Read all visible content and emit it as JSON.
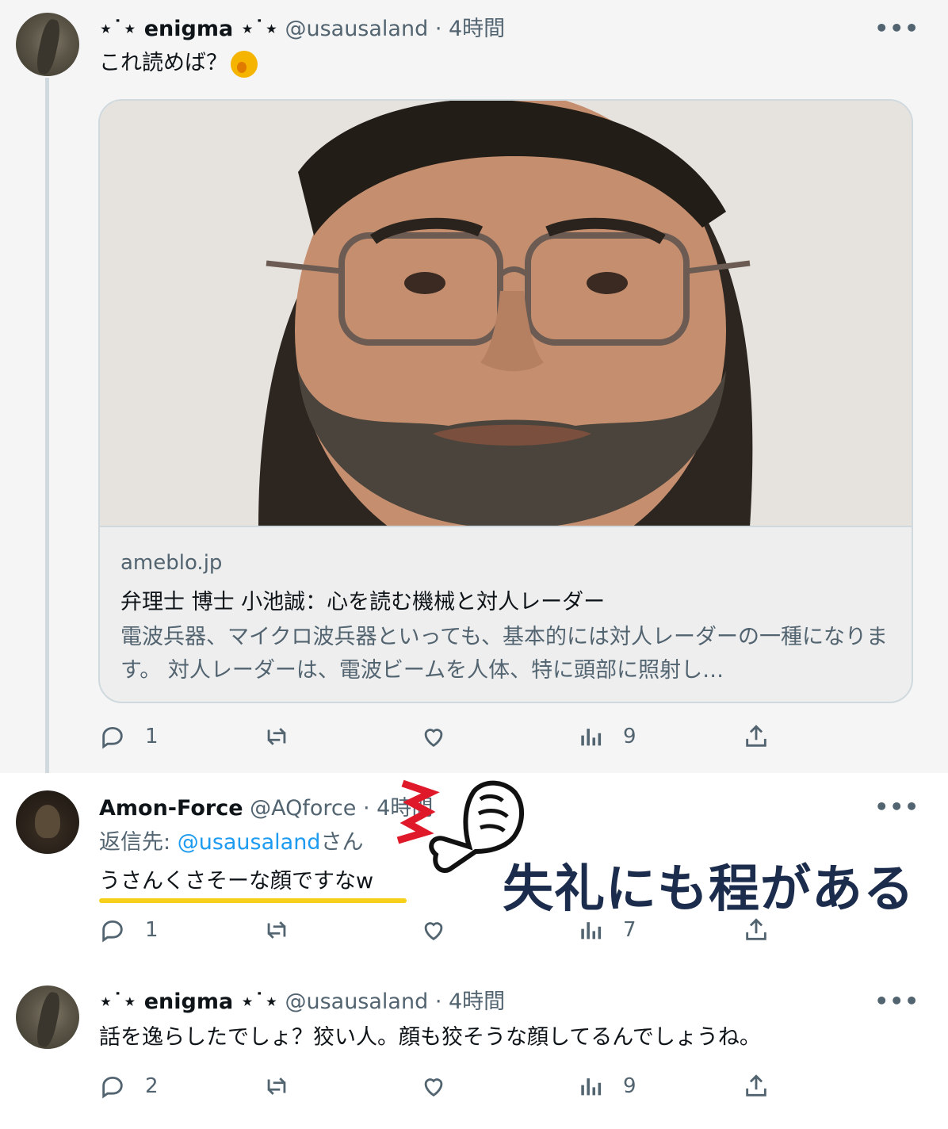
{
  "thread": [
    {
      "name": "⋆˙⋆ enigma ⋆˙⋆",
      "handle": "@usausaland",
      "separator": "·",
      "time": "4時間",
      "text": "これ読めば？",
      "emoji_icon": "yawning-face-emoji",
      "card": {
        "domain": "ameblo.jp",
        "title": "弁理士 博士 小池誠：心を読む機械と対人レーダー",
        "description": "電波兵器、マイクロ波兵器といっても、基本的には対人レーダーの一種になります。 対人レーダーは、電波ビームを人体、特に頭部に照射し…"
      },
      "metrics": {
        "replies": "1",
        "retweets": "",
        "likes": "",
        "views": "9"
      }
    },
    {
      "name": "Amon-Force",
      "handle": "@AQforce",
      "separator": "·",
      "time": "4時間",
      "reply_prefix": "返信先:",
      "reply_mention": "@usausaland",
      "reply_suffix": "さん",
      "text": "うさんくさそーな顔ですなw",
      "metrics": {
        "replies": "1",
        "retweets": "",
        "likes": "",
        "views": "7"
      }
    },
    {
      "name": "⋆˙⋆ enigma ⋆˙⋆",
      "handle": "@usausaland",
      "separator": "·",
      "time": "4時間",
      "text": "話を逸らしたでしょ？狡い人。顔も狡そうな顔してるんでしょうね。",
      "metrics": {
        "replies": "2",
        "retweets": "",
        "likes": "",
        "views": "9"
      }
    }
  ],
  "overlay": {
    "caption": "失礼にも程がある",
    "underline_color": "#f6d01b",
    "caption_color": "#1c2c4c",
    "accent_color": "#e0192a"
  },
  "more_label": "•••",
  "colors": {
    "link": "#1d9bf0",
    "muted": "#536471",
    "text": "#0f1419"
  }
}
